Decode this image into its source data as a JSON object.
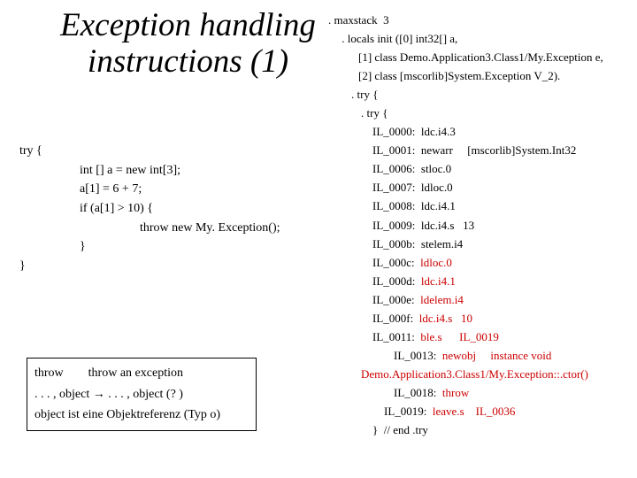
{
  "title": "Exception handling instructions (1)",
  "left": {
    "try": "try {",
    "l1": "int [] a = new int[3];",
    "l2": "a[1] = 6 + 7;",
    "l3": "if (a[1] > 10) {",
    "l4": "throw new My. Exception();",
    "l5": "}",
    "end": "}"
  },
  "note": {
    "l1a": "throw",
    "l1b": "throw an exception",
    "l2a": ". . . , object ",
    "l2b": " . . . , object (? )",
    "l3": "object ist eine Objektreferenz (Typ o)"
  },
  "il": {
    "r0": ". maxstack  3",
    "r1": " . locals init ([0] int32[] a,",
    "r2": "[1] class Demo.Application3.Class1/My.Exception e,",
    "r3": "[2] class [mscorlib]System.Exception V_2).",
    "r4": ". try {",
    "r5": ". try {",
    "r6": "IL_0000:  ldc.i4.3",
    "r7a": "IL_0001:  newarr",
    "r7b": "[mscorlib]System.Int32",
    "r8": "IL_0006:  stloc.0",
    "r9": "IL_0007:  ldloc.0",
    "r10": "IL_0008:  ldc.i4.1",
    "r11": "IL_0009:  ldc.i4.s   13",
    "r12": "IL_000b:  stelem.i4",
    "r13a": "IL_000c:  ",
    "r13b": "ldloc.0",
    "r14a": "IL_000d:  ",
    "r14b": "ldc.i4.1",
    "r15a": "IL_000e:  ",
    "r15b": "ldelem.i4",
    "r16a": "IL_000f:  ",
    "r16b": "ldc.i4.s   10",
    "r17a": "IL_0011:  ",
    "r17b": "ble.s",
    "r17c": "IL_0019",
    "r18a": "IL_0013:  ",
    "r18b": "newobj",
    "r18c": "instance void",
    "r18d": "Demo.Application3.Class1/My.Exception::.ctor()",
    "r19a": "IL_0018:  ",
    "r19b": "throw",
    "r20a": "IL_0019:  ",
    "r20b": "leave.s",
    "r20c": "IL_0036",
    "r21": "}  // end .try"
  }
}
